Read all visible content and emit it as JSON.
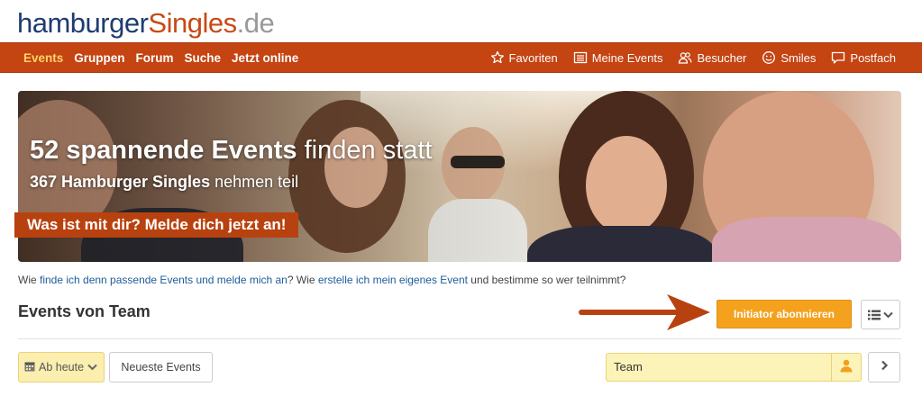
{
  "logo": {
    "part1": "hamburger",
    "part2": "Singles",
    "part3": ".de"
  },
  "nav": {
    "left": [
      {
        "label": "Events",
        "active": true
      },
      {
        "label": "Gruppen",
        "active": false
      },
      {
        "label": "Forum",
        "active": false
      },
      {
        "label": "Suche",
        "active": false
      },
      {
        "label": "Jetzt online",
        "active": false
      }
    ],
    "right": [
      {
        "label": "Favoriten",
        "icon": "star-icon"
      },
      {
        "label": "Meine Events",
        "icon": "list-icon"
      },
      {
        "label": "Besucher",
        "icon": "visitors-icon"
      },
      {
        "label": "Smiles",
        "icon": "smile-icon"
      },
      {
        "label": "Postfach",
        "icon": "mailbox-icon"
      }
    ]
  },
  "hero": {
    "headline_bold": "52 spannende Events",
    "headline_rest": " finden statt",
    "sub_bold": "367 Hamburger Singles",
    "sub_rest": " nehmen teil",
    "cta": "Was ist mit dir? Melde dich jetzt an!"
  },
  "help": {
    "t1": "Wie ",
    "link1": "finde ich denn passende Events und melde mich an",
    "t2": "? Wie ",
    "link2": "erstelle ich mein eigenes Event",
    "t3": " und bestimme so wer teilnimmt?"
  },
  "section": {
    "title": "Events von Team",
    "subscribe_label": "Initiator abonnieren"
  },
  "filters": {
    "date_label": "Ab heute",
    "newest_label": "Neueste Events",
    "search_value": "Team"
  },
  "colors": {
    "nav_bg": "#c44412",
    "nav_active": "#ffd36b",
    "subscribe_bg": "#f4a21d",
    "arrow": "#b8420f",
    "filter_bg": "#fcf3b8"
  }
}
